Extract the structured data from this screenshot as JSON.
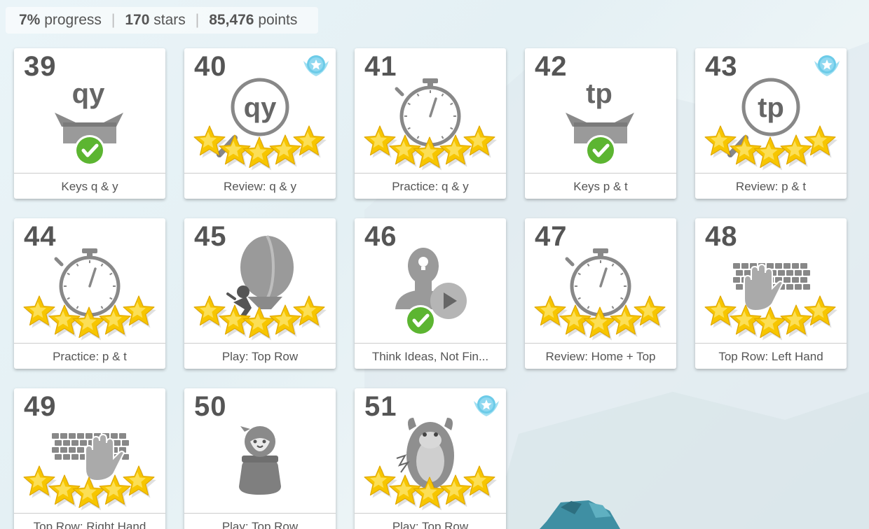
{
  "stats": {
    "progress_value": "7%",
    "progress_label": "progress",
    "stars_value": "170",
    "stars_label": "stars",
    "points_value": "85,476",
    "points_label": "points",
    "separator": "|"
  },
  "lessons": [
    {
      "number": "39",
      "label": "Keys q & y",
      "art_text": "qy",
      "icon": "gift-box-checkmark-icon",
      "stars": 0,
      "completed": true,
      "badge": false
    },
    {
      "number": "40",
      "label": "Review: q & y",
      "art_text": "qy",
      "icon": "magnifier-icon",
      "stars": 5,
      "completed": false,
      "badge": true
    },
    {
      "number": "41",
      "label": "Practice: q & y",
      "art_text": "",
      "icon": "stopwatch-icon",
      "stars": 5,
      "completed": false,
      "badge": false
    },
    {
      "number": "42",
      "label": "Keys p & t",
      "art_text": "tp",
      "icon": "gift-box-checkmark-icon",
      "stars": 0,
      "completed": true,
      "badge": false
    },
    {
      "number": "43",
      "label": "Review: p & t",
      "art_text": "tp",
      "icon": "magnifier-icon",
      "stars": 5,
      "completed": false,
      "badge": true
    },
    {
      "number": "44",
      "label": "Practice: p & t",
      "art_text": "",
      "icon": "stopwatch-icon",
      "stars": 5,
      "completed": false,
      "badge": false
    },
    {
      "number": "45",
      "label": "Play: Top Row",
      "art_text": "",
      "icon": "hot-air-balloon-ninja-icon",
      "stars": 5,
      "completed": false,
      "badge": false
    },
    {
      "number": "46",
      "label": "Think Ideas, Not Fin...",
      "art_text": "",
      "icon": "video-lightbulb-person-icon",
      "stars": 0,
      "completed": true,
      "badge": false
    },
    {
      "number": "47",
      "label": "Review: Home + Top",
      "art_text": "",
      "icon": "stopwatch-icon",
      "stars": 5,
      "completed": false,
      "badge": false
    },
    {
      "number": "48",
      "label": "Top Row: Left Hand",
      "art_text": "",
      "icon": "keyboard-left-hand-icon",
      "stars": 5,
      "completed": false,
      "badge": false
    },
    {
      "number": "49",
      "label": "Top Row: Right Hand",
      "art_text": "",
      "icon": "keyboard-right-hand-icon",
      "stars": 5,
      "completed": false,
      "badge": false
    },
    {
      "number": "50",
      "label": "Play: Top Row",
      "art_text": "",
      "icon": "ninja-pot-icon",
      "stars": 0,
      "completed": false,
      "badge": false
    },
    {
      "number": "51",
      "label": "Play: Top Row",
      "art_text": "",
      "icon": "yeti-monster-icon",
      "stars": 5,
      "completed": false,
      "badge": true
    }
  ],
  "colors": {
    "star_fill": "#f7c600",
    "star_light": "#fde97a",
    "check_green": "#5cb531",
    "badge_blue": "#6ccbe8",
    "icon_gray": "#888888"
  }
}
